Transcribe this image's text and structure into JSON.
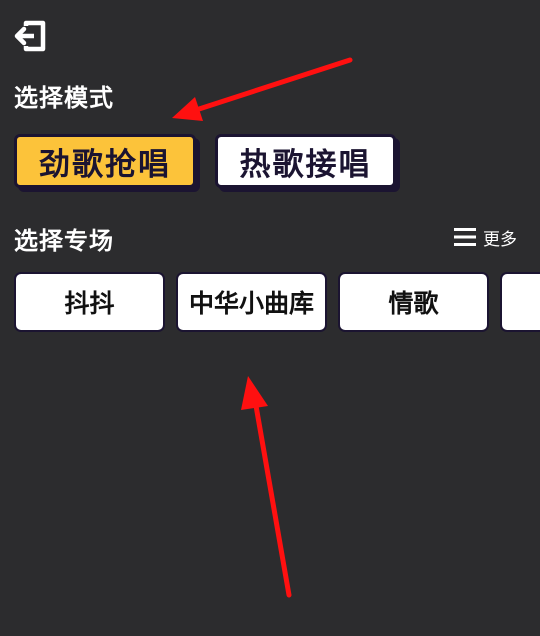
{
  "header": {
    "exit_icon": "exit-icon"
  },
  "mode_section": {
    "title": "选择模式",
    "modes": [
      {
        "label": "劲歌抢唱",
        "selected": true,
        "color": "#fcc33a"
      },
      {
        "label": "热歌接唱",
        "selected": false,
        "color": "#ffffff"
      }
    ]
  },
  "venue_section": {
    "title": "选择专场",
    "more": {
      "label": "更多",
      "icon": "menu-icon"
    },
    "venues": [
      {
        "label": "抖抖"
      },
      {
        "label": "中华小曲库"
      },
      {
        "label": "情歌"
      },
      {
        "label": ""
      }
    ]
  },
  "colors": {
    "background": "#2c2c2e",
    "accent": "#fcc33a",
    "annotation_arrow": "#ff1010"
  }
}
